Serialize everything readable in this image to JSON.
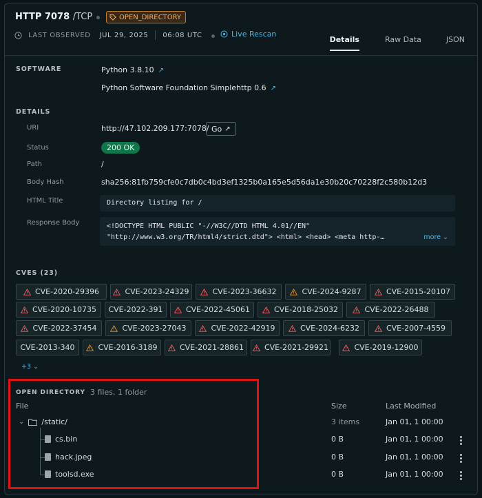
{
  "header": {
    "title": "HTTP 7078",
    "protocol": "/TCP",
    "tag": "OPEN_DIRECTORY",
    "last_observed_label": "LAST OBSERVED",
    "date": "JUL 29, 2025",
    "time": "06:08 UTC",
    "live_rescan": "Live Rescan",
    "tabs": [
      "Details",
      "Raw Data",
      "JSON"
    ]
  },
  "software": {
    "section_label": "SOFTWARE",
    "items": [
      "Python 3.8.10",
      "Python Software Foundation Simplehttp 0.6"
    ]
  },
  "details": {
    "section_label": "DETAILS",
    "uri_label": "URI",
    "uri_value": "http://47.102.209.177:7078/",
    "go_label": "Go",
    "status_label": "Status",
    "status_value": "200 OK",
    "path_label": "Path",
    "path_value": "/",
    "body_hash_label": "Body Hash",
    "body_hash_value": "sha256:81fb759cfe0c7db0c4bd3ef1325b0a165e5d56da1e30b20c70228f2c580b12d3",
    "html_title_label": "HTML Title",
    "html_title_value": "Directory listing for /",
    "response_body_label": "Response Body",
    "response_body_line1": "<!DOCTYPE HTML PUBLIC \"-//W3C//DTD HTML 4.01//EN\"",
    "response_body_line2": "\"http://www.w3.org/TR/html4/strict.dtd\"> <html> <head> <meta http-…",
    "more_label": "more"
  },
  "cves": {
    "section_label": "CVES (23)",
    "items": [
      {
        "id": "CVE-2020-29396",
        "severity": "high"
      },
      {
        "id": "CVE-2023-24329",
        "severity": "high"
      },
      {
        "id": "CVE-2023-36632",
        "severity": "high"
      },
      {
        "id": "CVE-2024-9287",
        "severity": "medium"
      },
      {
        "id": "CVE-2015-20107",
        "severity": "high"
      },
      {
        "id": "CVE-2020-10735",
        "severity": "high"
      },
      {
        "id": "CVE-2022-391",
        "severity": "none"
      },
      {
        "id": "CVE-2022-45061",
        "severity": "high"
      },
      {
        "id": "CVE-2018-25032",
        "severity": "high"
      },
      {
        "id": "CVE-2022-26488",
        "severity": "high"
      },
      {
        "id": "CVE-2022-37454",
        "severity": "high"
      },
      {
        "id": "CVE-2023-27043",
        "severity": "medium"
      },
      {
        "id": "CVE-2022-42919",
        "severity": "high"
      },
      {
        "id": "CVE-2024-6232",
        "severity": "high"
      },
      {
        "id": "CVE-2007-4559",
        "severity": "high"
      },
      {
        "id": "CVE-2013-340",
        "severity": "none"
      },
      {
        "id": "CVE-2016-3189",
        "severity": "medium"
      },
      {
        "id": "CVE-2021-28861",
        "severity": "high"
      },
      {
        "id": "CVE-2021-29921",
        "severity": "high"
      },
      {
        "id": "CVE-2019-12900",
        "severity": "high"
      }
    ],
    "more_label": "+3"
  },
  "open_directory": {
    "section_label": "OPEN DIRECTORY",
    "summary": "3 files, 1 folder",
    "col_file": "File",
    "col_size": "Size",
    "col_modified": "Last Modified",
    "folder": {
      "name": "/static/",
      "size": "3 items",
      "modified": "Jan 01, 1 00:00"
    },
    "files": [
      {
        "name": "cs.bin",
        "size": "0 B",
        "modified": "Jan 01, 1 00:00"
      },
      {
        "name": "hack.jpeg",
        "size": "0 B",
        "modified": "Jan 01, 1 00:00"
      },
      {
        "name": "toolsd.exe",
        "size": "0 B",
        "modified": "Jan 01, 1 00:00"
      }
    ]
  },
  "colors": {
    "high": "#e05a5a",
    "medium": "#d58a32",
    "accent": "#4fb6e9",
    "status_ok": "#11774a",
    "highlight_box": "#e01212"
  }
}
